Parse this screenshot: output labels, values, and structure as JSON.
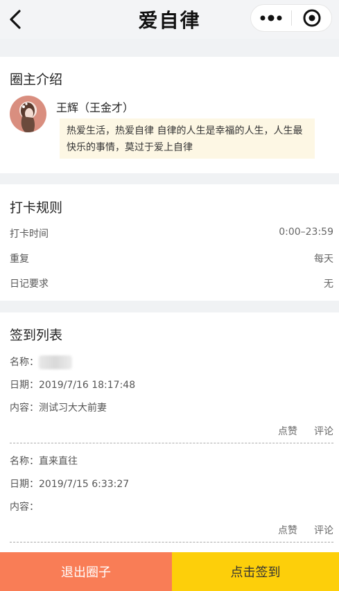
{
  "nav": {
    "title": "爱自律"
  },
  "owner": {
    "section_title": "圈主介绍",
    "name": "王辉（王金才）",
    "bio": "热爱生活，热爱自律 自律的人生是幸福的人生，人生最快乐的事情，莫过于爱上自律"
  },
  "rules": {
    "section_title": "打卡规则",
    "items": [
      {
        "label": "打卡时间",
        "value": "0:00–23:59"
      },
      {
        "label": "重复",
        "value": "每天"
      },
      {
        "label": "日记要求",
        "value": "无"
      }
    ]
  },
  "checkins": {
    "section_title": "签到列表",
    "labels": {
      "name": "名称：",
      "date": "日期：",
      "content": "内容："
    },
    "like_label": "点赞",
    "comment_label": "评论",
    "entries": [
      {
        "name": "",
        "date": "2019/7/16 18:17:48",
        "content": "测试习大大前妻"
      },
      {
        "name": "直来直往",
        "date": "2019/7/15 6:33:27",
        "content": ""
      }
    ]
  },
  "footer": {
    "exit_label": "退出圈子",
    "signin_label": "点击签到"
  },
  "colors": {
    "exit": "#f97d56",
    "signin": "#fdcf0a",
    "bio_bg": "#fdf7e4"
  }
}
